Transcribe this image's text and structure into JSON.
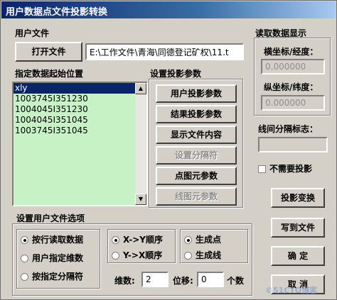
{
  "window": {
    "title": "用户数据点文件投影转换"
  },
  "user_file": {
    "group_label": "用户文件",
    "open_button": "打开文件",
    "path_value": "E:\\工作文件\\青海\\同德登记矿权\\11.t"
  },
  "start_position": {
    "label": "指定数据起始位置",
    "items": [
      "xly",
      "1003745I351230",
      "1004045I351230",
      "1004045I351045",
      "1003745I351045"
    ],
    "selected_index": 0
  },
  "projection_params": {
    "label": "设置投影参数",
    "buttons": [
      {
        "label": "用户投影参数",
        "enabled": true
      },
      {
        "label": "结果投影参数",
        "enabled": true
      },
      {
        "label": "显示文件内容",
        "enabled": true
      },
      {
        "label": "设置分隔符",
        "enabled": false
      },
      {
        "label": "点图元参数",
        "enabled": true
      },
      {
        "label": "线图元参数",
        "enabled": false
      }
    ]
  },
  "read_display": {
    "label": "读取数据显示",
    "x_label": "横坐标/经度：",
    "x_value": "0.000000",
    "y_label": "纵坐标/纬度：",
    "y_value": "0.000000"
  },
  "line_separator": {
    "label": "线间分隔标志：",
    "value": ""
  },
  "no_projection": {
    "label": "不需要投影",
    "checked": false
  },
  "actions": {
    "project": "投影变换",
    "write": "写到文件",
    "ok": "确 定",
    "cancel": "取 消"
  },
  "file_options": {
    "label": "设置用户文件选项",
    "read_mode": [
      {
        "label": "按行读取数据",
        "selected": true
      },
      {
        "label": "用户指定维数",
        "selected": false
      },
      {
        "label": "按指定分隔符",
        "selected": false
      }
    ],
    "order": [
      {
        "label": "X->Y顺序",
        "selected": true
      },
      {
        "label": "Y->X顺序",
        "selected": false
      }
    ],
    "generate": [
      {
        "label": "生成点",
        "selected": true
      },
      {
        "label": "生成线",
        "selected": false
      }
    ],
    "dimension_label": "维数:",
    "dimension_value": "2",
    "offset_label": "位移:",
    "offset_value": "0",
    "count_unit": "个数"
  },
  "watermark": {
    "text": "©51CTO博客"
  }
}
